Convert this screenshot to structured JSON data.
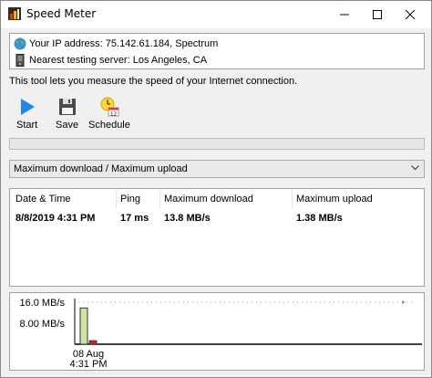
{
  "window": {
    "title": "Speed Meter",
    "minimize_label": "—",
    "maximize_label": "□",
    "close_label": "✕"
  },
  "info": {
    "ip_text": "Your IP address: 75.142.61.184, Spectrum",
    "server_text": "Nearest testing server: Los Angeles, CA"
  },
  "description": "This tool lets you measure the speed of your Internet connection.",
  "toolbar": {
    "start_label": "Start",
    "save_label": "Save",
    "schedule_label": "Schedule",
    "schedule_badge": "12"
  },
  "progress": {
    "fraction": 0
  },
  "mode_select": {
    "value": "Maximum download / Maximum upload"
  },
  "results": {
    "columns": [
      "Date & Time",
      "Ping",
      "Maximum download",
      "Maximum upload"
    ],
    "rows": [
      [
        "8/8/2019 4:31 PM",
        "17 ms",
        "13.8 MB/s",
        "1.38 MB/s"
      ]
    ]
  },
  "colors": {
    "accent": "#0078d7",
    "download_bar": "#cde6a6",
    "upload_bar": "#cc2222",
    "progress_track": "#e6e6e6"
  },
  "chart_data": {
    "type": "bar",
    "categories": [
      "08 Aug\n4:31 PM"
    ],
    "series": [
      {
        "values": [
          13.8
        ]
      },
      {
        "values": [
          1.38
        ]
      }
    ],
    "y_tick_labels": [
      "16.0 MB/s",
      "8.00 MB/s"
    ],
    "y_ticks": [
      16,
      8
    ],
    "ylim": [
      0,
      16
    ],
    "x_tick_lines": [
      "08 Aug",
      "4:31 PM"
    ],
    "grid": true
  }
}
